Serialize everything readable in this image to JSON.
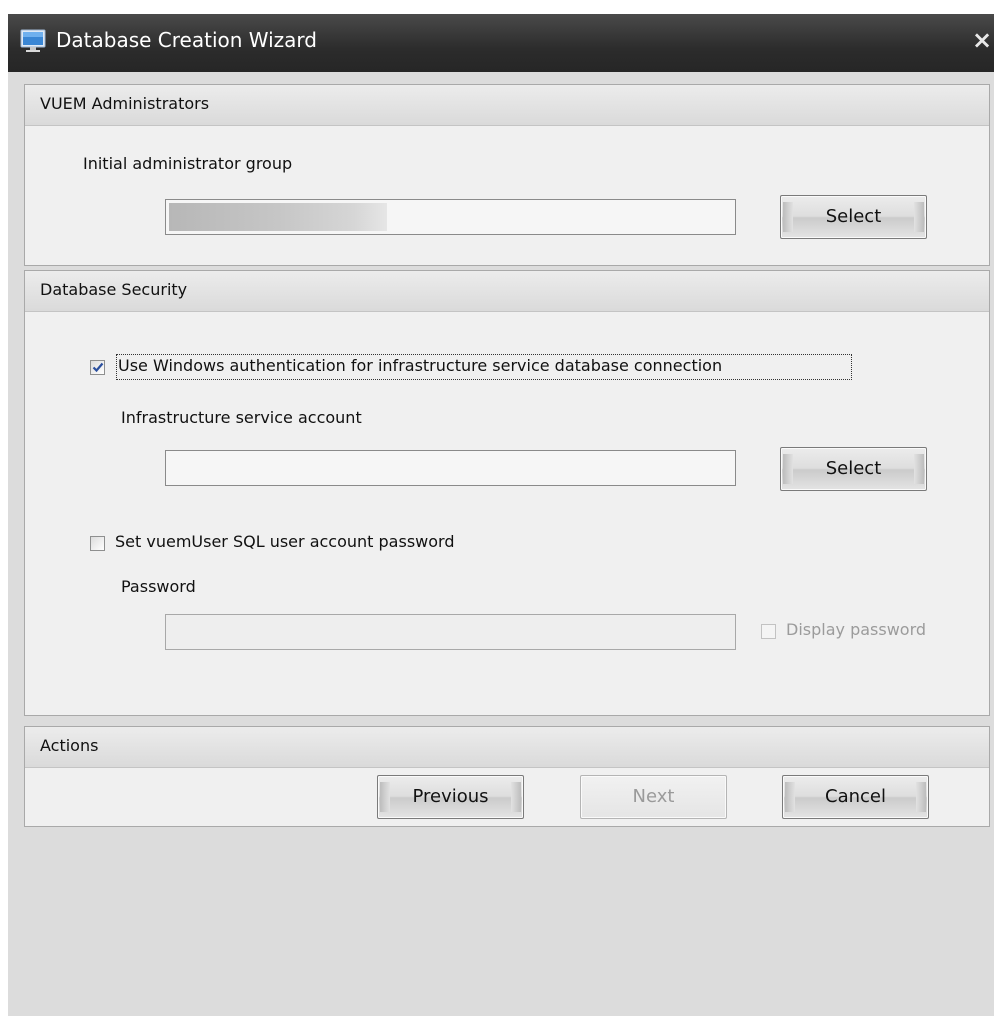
{
  "window": {
    "title": "Database Creation Wizard",
    "close_glyph": "×",
    "app_icon": "monitor-icon"
  },
  "admins_section": {
    "title": "VUEM Administrators",
    "group_label": "Initial administrator group",
    "group_value": "",
    "select_label": "Select"
  },
  "security_section": {
    "title": "Database Security",
    "use_windows_auth": {
      "label": "Use Windows authentication for infrastructure service database connection",
      "checked": true
    },
    "service_account_label": "Infrastructure service account",
    "service_account_value": "",
    "select_label": "Select",
    "set_password": {
      "label": "Set vuemUser SQL user account password",
      "checked": false
    },
    "password_label": "Password",
    "password_value": "",
    "display_password": {
      "label": "Display password",
      "checked": false,
      "enabled": false
    }
  },
  "actions_section": {
    "title": "Actions",
    "previous_label": "Previous",
    "next_label": "Next",
    "cancel_label": "Cancel"
  },
  "colors": {
    "titlebar": "#2f2f2f",
    "checkmark": "#2a4f9e",
    "client_bg": "#dcdcdc"
  }
}
